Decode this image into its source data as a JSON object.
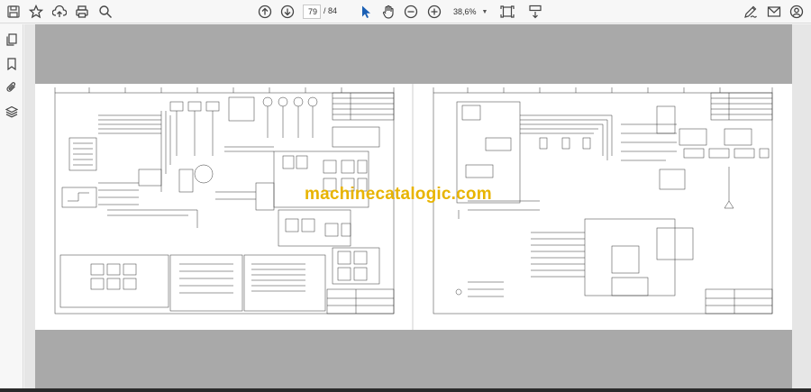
{
  "toolbar": {
    "current_page": "79",
    "page_separator": "/ 84",
    "zoom_value": "38,6%",
    "icons": [
      "save-icon",
      "star-icon",
      "upload-icon",
      "print-icon",
      "zoom-search-icon",
      "page-up-icon",
      "page-down-icon",
      "select-cursor-icon",
      "hand-icon",
      "zoom-out-icon",
      "zoom-in-icon",
      "fit-page-icon",
      "scroll-mode-icon",
      "sign-icon",
      "mail-icon",
      "account-icon"
    ]
  },
  "sidebar": {
    "icons": [
      "copy-pages-icon",
      "bookmark-icon",
      "attachment-icon",
      "layers-icon"
    ]
  },
  "document": {
    "watermark": "machinecatalogic.com"
  }
}
